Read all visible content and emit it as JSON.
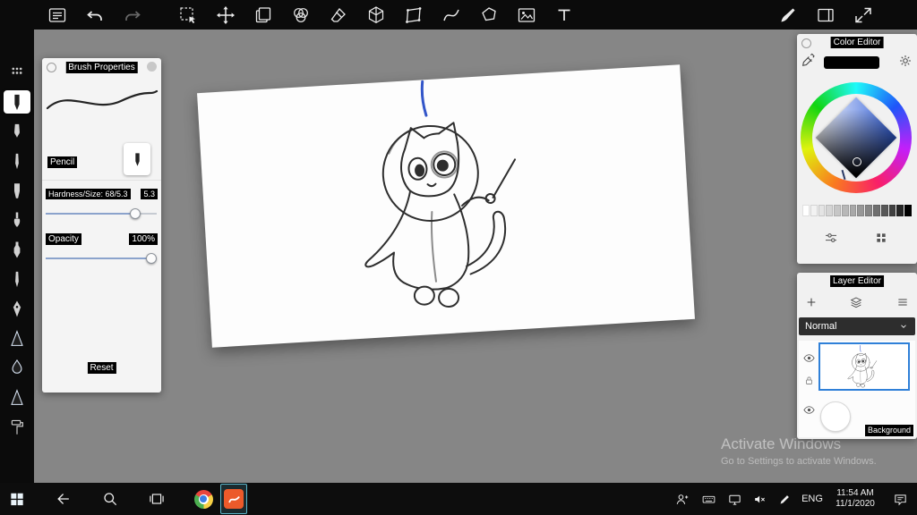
{
  "window": {
    "bg_color": "#868686",
    "toolbar_color": "#0b0b0b",
    "accent_color": "#2f80d8"
  },
  "top_toolbar": {
    "left_icons": [
      {
        "name": "menu-icon",
        "sym": "sym-menu"
      },
      {
        "name": "undo-icon",
        "sym": "sym-undo"
      },
      {
        "name": "redo-icon",
        "sym": "sym-redo",
        "muted": true
      },
      {
        "name": "select-icon",
        "sym": "sym-select",
        "gap": true
      },
      {
        "name": "move-icon",
        "sym": "sym-move"
      },
      {
        "name": "duplicate-icon",
        "sym": "sym-copy"
      },
      {
        "name": "blend-icon",
        "sym": "sym-blend"
      },
      {
        "name": "eraser-icon",
        "sym": "sym-eraser"
      },
      {
        "name": "mesh-icon",
        "sym": "sym-mesh"
      },
      {
        "name": "transform-icon",
        "sym": "sym-transform"
      },
      {
        "name": "curve-icon",
        "sym": "sym-curve"
      },
      {
        "name": "lasso-icon",
        "sym": "sym-lasso"
      },
      {
        "name": "image-icon",
        "sym": "sym-image"
      },
      {
        "name": "text-icon",
        "sym": "sym-text"
      }
    ],
    "right_icons": [
      {
        "name": "quick-brush-icon",
        "sym": "sym-quickbrush"
      },
      {
        "name": "panels-icon",
        "sym": "sym-panels"
      },
      {
        "name": "fullscreen-icon",
        "sym": "sym-expand"
      }
    ]
  },
  "left_toolbar": {
    "header_icon": "tool-grid-icon",
    "tools": [
      {
        "name": "tool-pencil",
        "sym": "sym-t-pencil",
        "selected": true
      },
      {
        "name": "tool-fountain-pen",
        "sym": "sym-t-fountain"
      },
      {
        "name": "tool-ink-pen",
        "sym": "sym-t-fineliner"
      },
      {
        "name": "tool-marker",
        "sym": "sym-t-marker"
      },
      {
        "name": "tool-paintbrush",
        "sym": "sym-t-brush"
      },
      {
        "name": "tool-airbrush",
        "sym": "sym-t-airbrush"
      },
      {
        "name": "tool-fine-liner",
        "sym": "sym-t-fineliner"
      },
      {
        "name": "tool-calligraphy-nib",
        "sym": "sym-t-nib"
      },
      {
        "name": "tool-palette-knife",
        "sym": "sym-t-knife",
        "tint": true
      },
      {
        "name": "tool-water-drop",
        "sym": "sym-t-drop",
        "tint": true
      },
      {
        "name": "tool-smudge-knife",
        "sym": "sym-t-knife",
        "tint": true
      },
      {
        "name": "tool-paint-roller",
        "sym": "sym-t-roller"
      }
    ]
  },
  "brush_panel": {
    "title": "Brush Properties",
    "tool_name": "Pencil",
    "hardness_label": "Hardness/Size: 68/5.3",
    "hardness_value": "5.3",
    "hardness_percent": 81,
    "opacity_label": "Opacity",
    "opacity_value": "100%",
    "opacity_percent": 95,
    "reset_label": "Reset"
  },
  "color_panel": {
    "title": "Color Editor",
    "current_color": "#000000",
    "selected_hue": "#2a59d8",
    "grayscale_swatches": [
      "#ffffff",
      "#f2f2f2",
      "#e4e4e4",
      "#d5d5d5",
      "#c6c6c6",
      "#b7b7b7",
      "#a8a8a8",
      "#979797",
      "#858585",
      "#6f6f6f",
      "#585858",
      "#414141",
      "#262626",
      "#000000"
    ]
  },
  "layer_panel": {
    "title": "Layer Editor",
    "blend_mode": "Normal",
    "background_label": "Background"
  },
  "watermark": {
    "line1": "Activate Windows",
    "line2": "Go to Settings to activate Windows."
  },
  "taskbar": {
    "language": "ENG",
    "time": "11:54 AM",
    "date": "11/1/2020"
  }
}
